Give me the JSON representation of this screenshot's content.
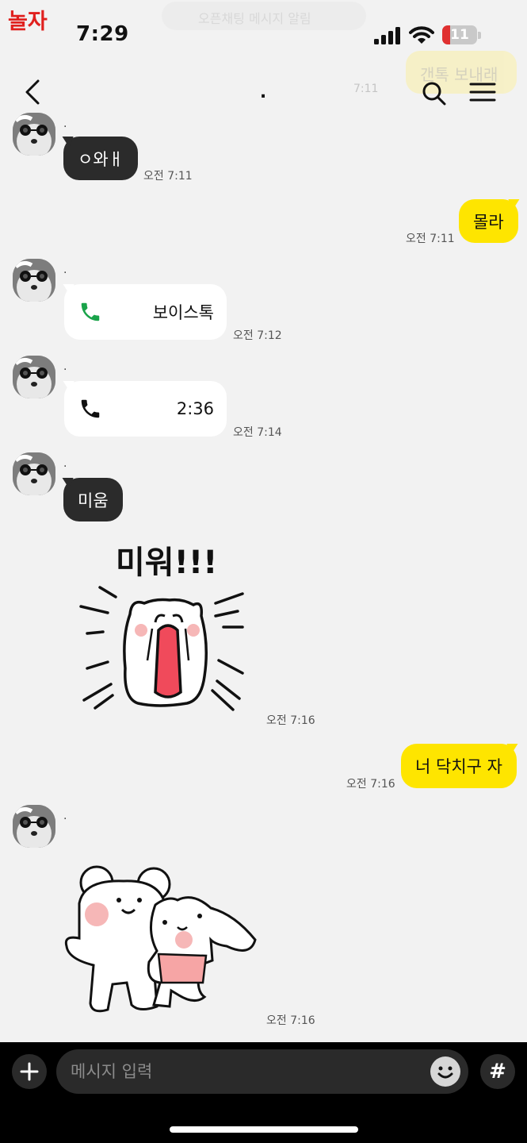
{
  "status_bar": {
    "watermark": "놀자",
    "time": "7:29",
    "notification_preview": "오픈채팅 메시지 알림",
    "battery": "11"
  },
  "ghost_preview": {
    "text": "갠톡 보내래",
    "time": "7:11"
  },
  "header": {
    "title": "."
  },
  "messages": [
    {
      "side": "left",
      "kind": "text",
      "sender": ".",
      "text": "ㅇ와ㅐ",
      "time": "오전 7:11"
    },
    {
      "side": "right",
      "kind": "text",
      "text": "몰라",
      "time": "오전 7:11"
    },
    {
      "side": "left",
      "kind": "call",
      "sender": ".",
      "icon": "phone-icon-green",
      "label": "보이스톡",
      "time": "오전 7:12"
    },
    {
      "side": "left",
      "kind": "call",
      "sender": ".",
      "icon": "phone-icon-black",
      "label": "2:36",
      "time": "오전 7:14"
    },
    {
      "side": "left",
      "kind": "text",
      "sender": ".",
      "text": "미움",
      "time": ""
    },
    {
      "side": "left",
      "kind": "sticker",
      "sticker_text": "미워!!!",
      "time": "오전 7:16"
    },
    {
      "side": "right",
      "kind": "text",
      "text": "너 닥치구 자",
      "time": "오전 7:16"
    },
    {
      "side": "left",
      "kind": "sticker",
      "sender": ".",
      "sticker_text": "",
      "time": "오전 7:16"
    }
  ],
  "input": {
    "placeholder": "메시지 입력"
  },
  "colors": {
    "background": "#f2f2f2",
    "my_bubble": "#fee500",
    "their_bubble": "#2b2b2b",
    "call_bubble": "#ffffff",
    "voice_call_icon": "#1aa34a"
  }
}
